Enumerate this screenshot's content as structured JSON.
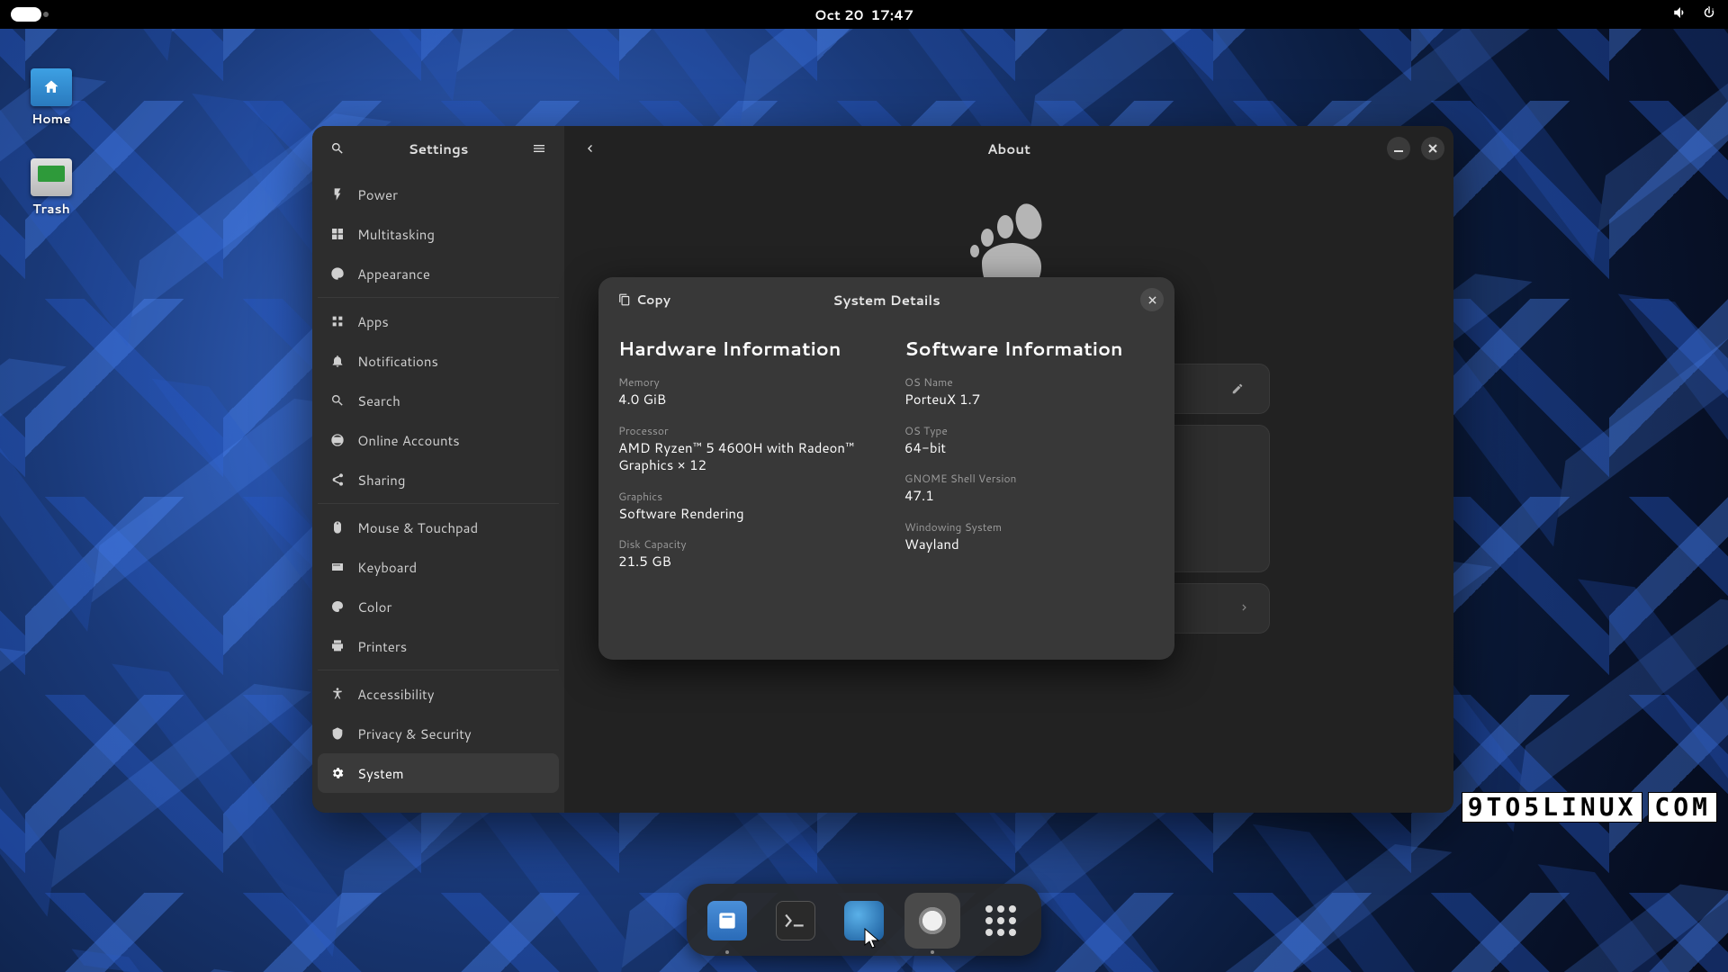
{
  "topbar": {
    "date": "Oct 20",
    "time": "17:47"
  },
  "desktop": {
    "home": "Home",
    "trash": "Trash"
  },
  "window": {
    "sidebar_title": "Settings",
    "content_title": "About",
    "nav": {
      "power": "Power",
      "multitasking": "Multitasking",
      "appearance": "Appearance",
      "apps": "Apps",
      "notifications": "Notifications",
      "search": "Search",
      "online_accounts": "Online Accounts",
      "sharing": "Sharing",
      "mouse": "Mouse & Touchpad",
      "keyboard": "Keyboard",
      "color": "Color",
      "printers": "Printers",
      "accessibility": "Accessibility",
      "privacy": "Privacy & Security",
      "system": "System"
    },
    "about": {
      "system_details": "System Details"
    }
  },
  "dialog": {
    "title": "System Details",
    "copy": "Copy",
    "hardware_heading": "Hardware Information",
    "software_heading": "Software Information",
    "hw": {
      "memory_lbl": "Memory",
      "memory_val": "4.0 GiB",
      "processor_lbl": "Processor",
      "processor_val": "AMD Ryzen™ 5 4600H with Radeon™ Graphics × 12",
      "graphics_lbl": "Graphics",
      "graphics_val": "Software Rendering",
      "disk_lbl": "Disk Capacity",
      "disk_val": "21.5 GB"
    },
    "sw": {
      "os_name_lbl": "OS Name",
      "os_name_val": "PorteuX 1.7",
      "os_type_lbl": "OS Type",
      "os_type_val": "64-bit",
      "gnome_lbl": "GNOME Shell Version",
      "gnome_val": "47.1",
      "windowing_lbl": "Windowing System",
      "windowing_val": "Wayland"
    }
  },
  "watermark": {
    "a": "9TO5LINUX",
    "b": "COM"
  }
}
